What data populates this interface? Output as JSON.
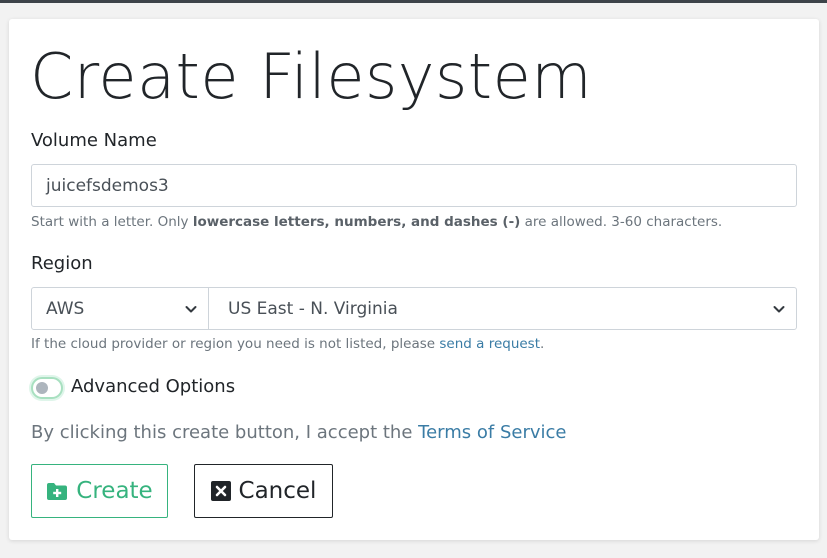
{
  "page": {
    "title": "Create Filesystem"
  },
  "volume": {
    "label": "Volume Name",
    "value": "juicefsdemos3",
    "help_prefix": "Start with a letter. Only ",
    "help_bold": "lowercase letters, numbers, and dashes (-)",
    "help_suffix": " are allowed. 3-60 characters."
  },
  "region": {
    "label": "Region",
    "provider_selected": "AWS",
    "region_selected": "US East - N. Virginia",
    "help_prefix": "If the cloud provider or region you need is not listed, please ",
    "help_link": "send a request",
    "help_suffix": "."
  },
  "advanced": {
    "label": "Advanced Options",
    "enabled": false
  },
  "terms": {
    "prefix": "By clicking this create button, I accept the ",
    "link": "Terms of Service"
  },
  "actions": {
    "create_label": "Create",
    "cancel_label": "Cancel"
  },
  "colors": {
    "accent_green": "#36b37e",
    "link_blue": "#3a7ca5",
    "topbar": "#3d4349"
  },
  "icons": {
    "create": "folder-plus-icon",
    "cancel": "close-square-icon",
    "select": "chevron-down-icon"
  }
}
